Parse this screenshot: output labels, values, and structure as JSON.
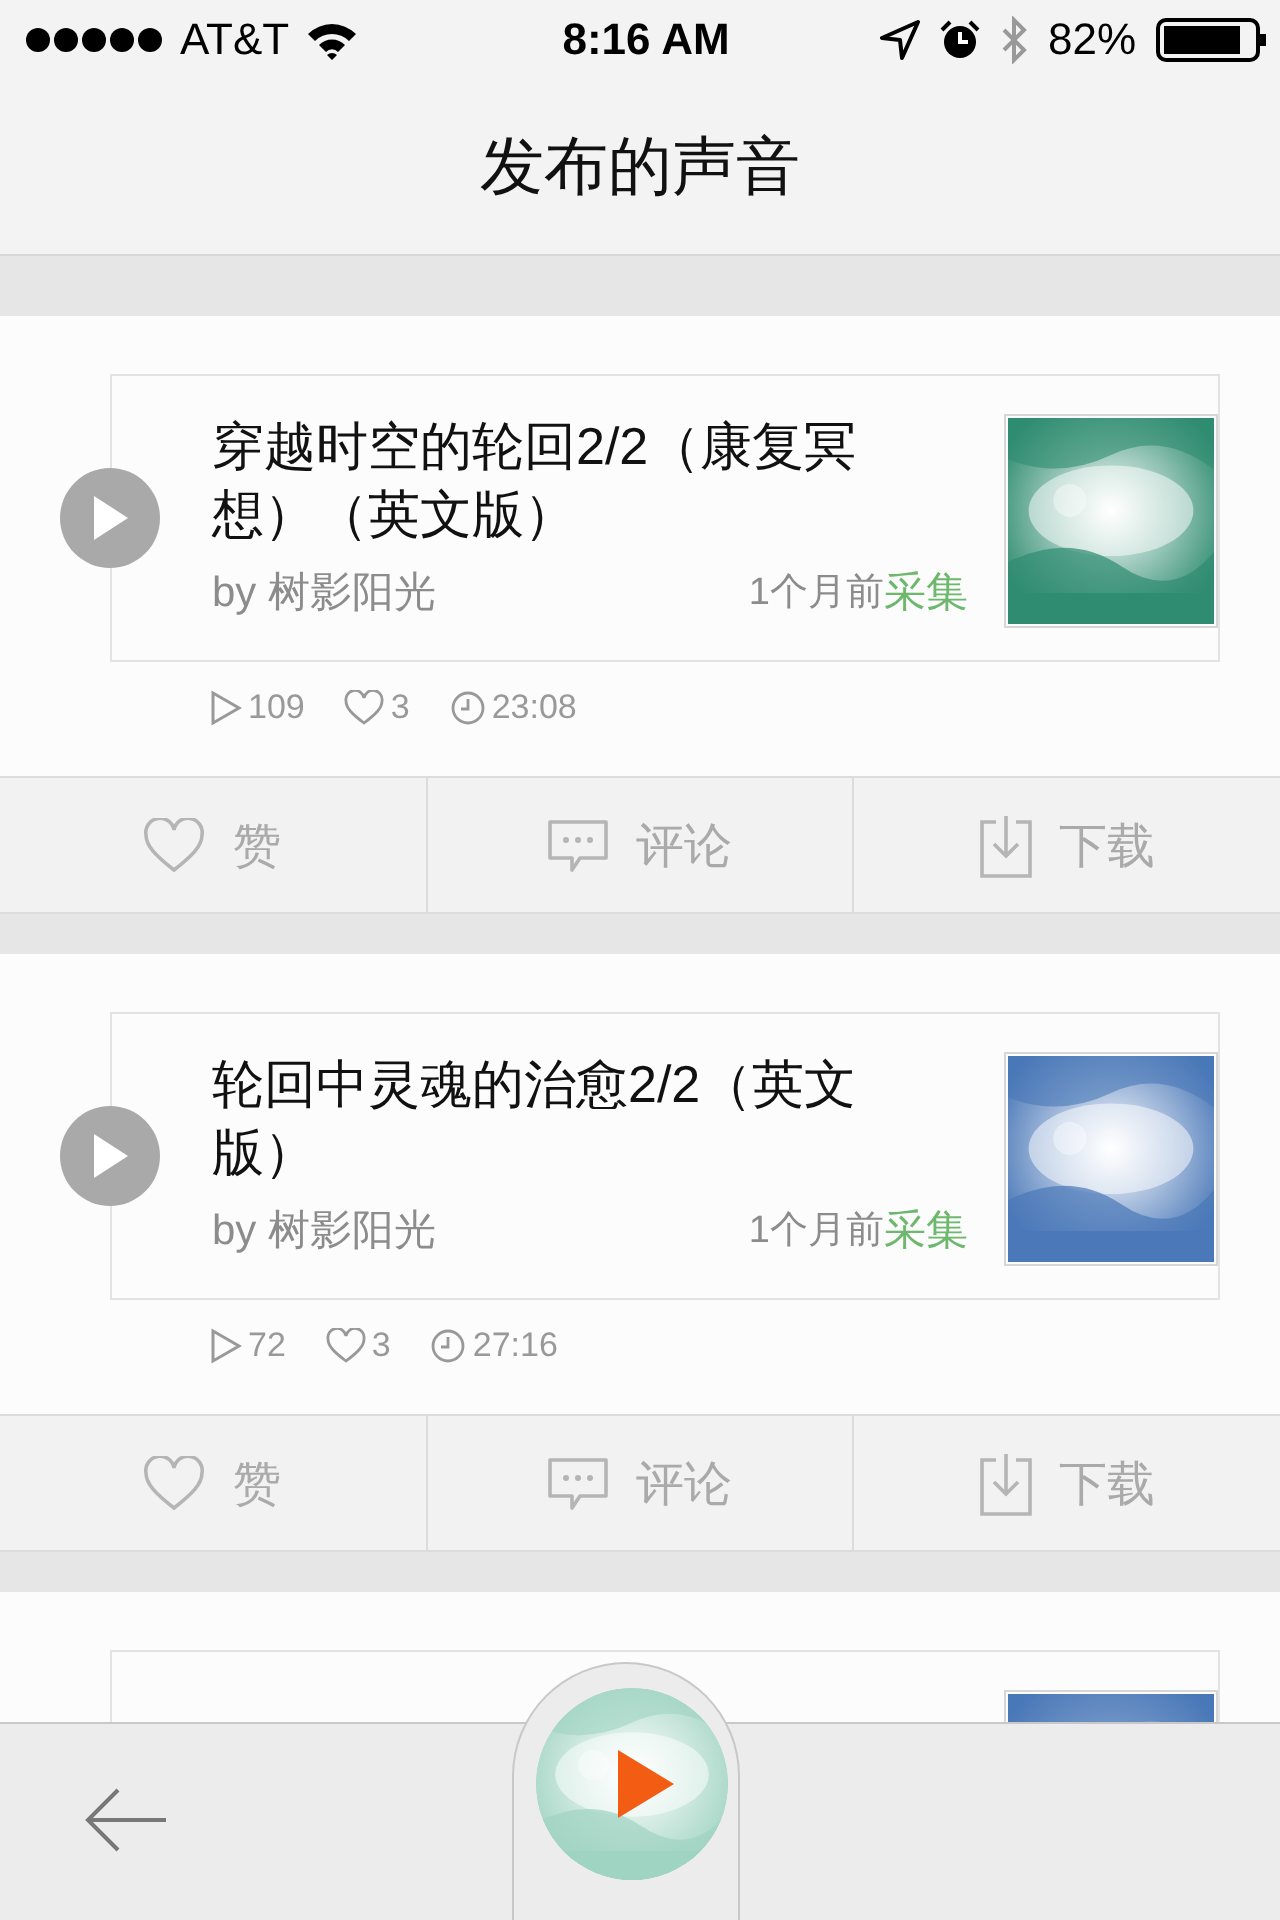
{
  "status_bar": {
    "carrier": "AT&T",
    "time": "8:16 AM",
    "battery": "82%"
  },
  "nav_bar": {
    "title": "发布的声音"
  },
  "sounds": [
    {
      "title": "穿越时空的轮回2/2（康复冥想）（英文版）",
      "author": "by 树影阳光",
      "age": "1个月前",
      "action": "采集",
      "plays": "109",
      "likes": "3",
      "duration": "23:08",
      "cover": {
        "kind": "picture",
        "color": "#2f8c70"
      },
      "actions": [
        {
          "kind": "like",
          "label": "赞"
        },
        {
          "kind": "comment",
          "label": "评论"
        },
        {
          "kind": "download",
          "label": "下载"
        }
      ]
    },
    {
      "title": "轮回中灵魂的治愈2/2（英文版）",
      "author": "by 树影阳光",
      "age": "1个月前",
      "action": "采集",
      "plays": "72",
      "likes": "3",
      "duration": "27:16",
      "cover": {
        "kind": "picture",
        "color": "#4a78b8"
      },
      "actions": [
        {
          "kind": "like",
          "label": "赞"
        },
        {
          "kind": "comment",
          "label": "评论"
        },
        {
          "kind": "download",
          "label": "下载"
        }
      ]
    },
    {
      "cover": {
        "kind": "picture",
        "color": "#4a78b8"
      }
    }
  ],
  "tab_bar": {
    "player": {
      "cover": {
        "kind": "picture",
        "color": "#9fd3c2"
      }
    }
  }
}
